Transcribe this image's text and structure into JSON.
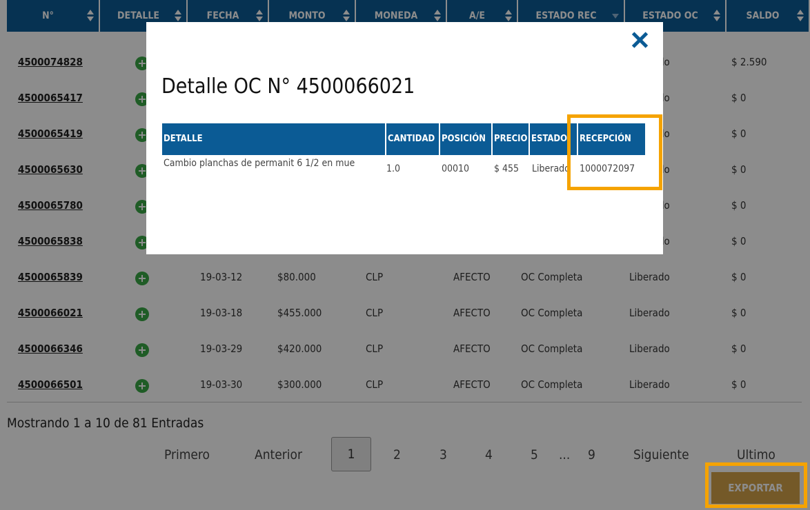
{
  "table": {
    "headers": [
      "N°",
      "DETALLE",
      "FECHA",
      "MONTO",
      "MONEDA",
      "A/E",
      "ESTADO REC",
      "ESTADO OC",
      "SALDO"
    ],
    "rows": [
      {
        "n": "4500074828",
        "fecha": "",
        "monto": "",
        "moneda": "",
        "ae": "",
        "estado_rec": "",
        "estado_oc": "Liberado",
        "saldo": "$ 2.590"
      },
      {
        "n": "4500065417",
        "fecha": "",
        "monto": "",
        "moneda": "",
        "ae": "",
        "estado_rec": "",
        "estado_oc": "Liberado",
        "saldo": "$ 0"
      },
      {
        "n": "4500065419",
        "fecha": "",
        "monto": "",
        "moneda": "",
        "ae": "",
        "estado_rec": "",
        "estado_oc": "Liberado",
        "saldo": "$ 0"
      },
      {
        "n": "4500065630",
        "fecha": "",
        "monto": "",
        "moneda": "",
        "ae": "",
        "estado_rec": "",
        "estado_oc": "Liberado",
        "saldo": "$ 0"
      },
      {
        "n": "4500065780",
        "fecha": "",
        "monto": "",
        "moneda": "",
        "ae": "",
        "estado_rec": "",
        "estado_oc": "Liberado",
        "saldo": "$ 0"
      },
      {
        "n": "4500065838",
        "fecha": "",
        "monto": "",
        "moneda": "",
        "ae": "",
        "estado_rec": "",
        "estado_oc": "Liberado",
        "saldo": "$ 0"
      },
      {
        "n": "4500065839",
        "fecha": "19-03-12",
        "monto": "$80.000",
        "moneda": "CLP",
        "ae": "AFECTO",
        "estado_rec": "OC Completa",
        "estado_oc": "Liberado",
        "saldo": "$ 0"
      },
      {
        "n": "4500066021",
        "fecha": "19-03-18",
        "monto": "$455.000",
        "moneda": "CLP",
        "ae": "AFECTO",
        "estado_rec": "OC Completa",
        "estado_oc": "Liberado",
        "saldo": "$ 0"
      },
      {
        "n": "4500066346",
        "fecha": "19-03-29",
        "monto": "$420.000",
        "moneda": "CLP",
        "ae": "AFECTO",
        "estado_rec": "OC Completa",
        "estado_oc": "Liberado",
        "saldo": "$ 0"
      },
      {
        "n": "4500066501",
        "fecha": "19-03-30",
        "monto": "$300.000",
        "moneda": "CLP",
        "ae": "AFECTO",
        "estado_rec": "OC Completa",
        "estado_oc": "Liberado",
        "saldo": "$ 0"
      }
    ]
  },
  "pagination": {
    "showing": "Mostrando 1 a 10 de 81 Entradas",
    "first": "Primero",
    "prev": "Anterior",
    "pages": [
      "1",
      "2",
      "3",
      "4",
      "5",
      "...",
      "9"
    ],
    "current": "1",
    "next": "Siguiente",
    "last": "Ultimo"
  },
  "export_label": "EXPORTAR",
  "modal": {
    "title": "Detalle OC N° 4500066021",
    "headers": [
      "DETALLE",
      "CANTIDAD",
      "POSICIÓN",
      "PRECIO",
      "ESTADO",
      "RECEPCIÓN"
    ],
    "row": {
      "detalle": "Cambio planchas de permanit 6 1/2 en mue",
      "cantidad": "1.0",
      "posicion": "00010",
      "precio": "$ 455",
      "estado": "Liberado",
      "recepcion": "1000072097"
    }
  },
  "colors": {
    "header": "#0b5b95",
    "export": "#d3a24a",
    "highlight": "#f5a300",
    "add": "#3aa845"
  },
  "icons": {
    "add": "plus-circle-icon",
    "close": "close-icon",
    "sort": "sort-arrows-icon"
  }
}
